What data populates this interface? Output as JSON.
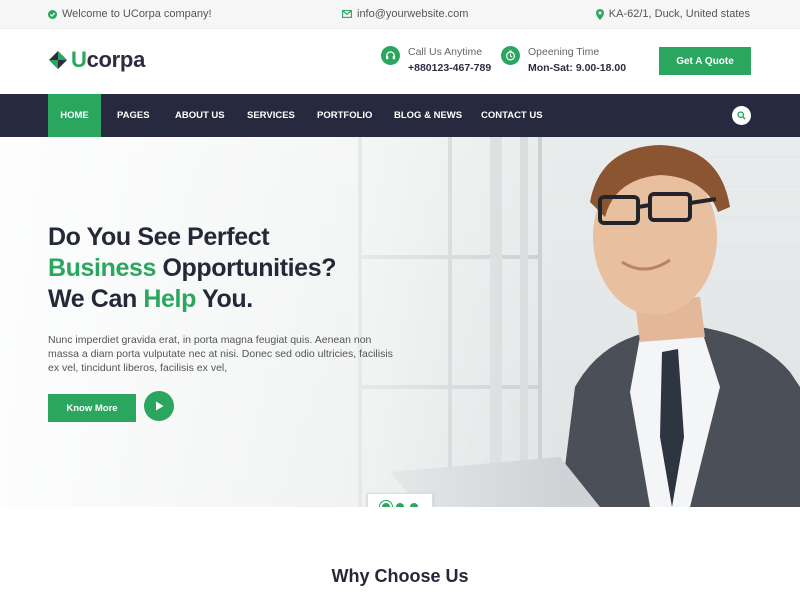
{
  "topbar": {
    "welcome": "Welcome to UCorpa company!",
    "email": "info@yourwebsite.com",
    "address": "KA-62/1, Duck, United states"
  },
  "header": {
    "logo_u": "U",
    "logo_rest": "corpa",
    "call_label": "Call Us Anytime",
    "call_value": "+880123-467-789",
    "time_label": "Opeening Time",
    "time_value": "Mon-Sat: 9.00-18.00",
    "quote_label": "Get A Quote"
  },
  "nav": {
    "items": [
      "HOME",
      "PAGES",
      "ABOUT US",
      "SERVICES",
      "PORTFOLIO",
      "BLOG & NEWS",
      "CONTACT US"
    ]
  },
  "hero": {
    "line1": "Do You See Perfect",
    "line2_green": "Business",
    "line2_rest": " Opportunities?",
    "line3_a": "We Can ",
    "line3_green": "Help",
    "line3_b": " You.",
    "text": "Nunc imperdiet gravida erat, in porta magna feugiat quis. Aenean non massa a diam porta vulputate nec at nisi. Donec sed odio ultricies, facilisis ex vel, tincidunt liberos, facilisis ex vel,",
    "know_more": "Know More"
  },
  "why": {
    "title": "Why Choose Us"
  },
  "colors": {
    "accent": "#2aa65e",
    "nav_bg": "#272a3f",
    "heading": "#252838"
  },
  "icons": {
    "welcome": "check-circle-icon",
    "email": "envelope-icon",
    "address": "map-pin-icon",
    "call": "headset-icon",
    "time": "clock-icon",
    "search": "search-icon",
    "play": "play-icon"
  }
}
